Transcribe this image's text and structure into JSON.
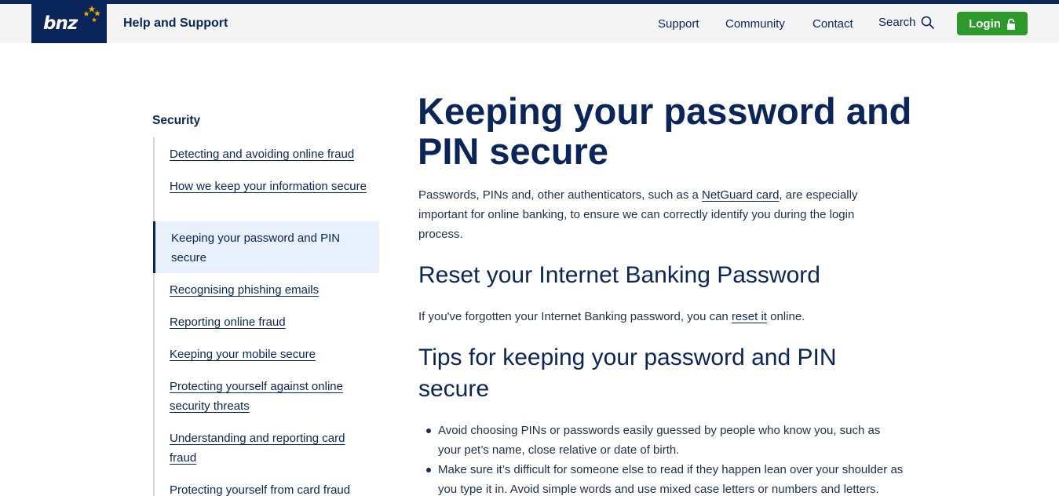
{
  "header": {
    "logo_text": "bnz",
    "site_title": "Help and Support",
    "nav": [
      "Support",
      "Community",
      "Contact",
      "Search"
    ],
    "login_label": "Login",
    "colors": {
      "navy": "#0a2559",
      "login_green": "#2b9a2b",
      "star_gold": "#f2a900"
    }
  },
  "sidebar": {
    "heading": "Security",
    "items": [
      {
        "label": "Detecting and avoiding online fraud",
        "active": false
      },
      {
        "label": "How we keep your information secure",
        "active": false
      },
      {
        "label": "Keeping your password and PIN secure",
        "active": true
      },
      {
        "label": "Recognising phishing emails",
        "active": false
      },
      {
        "label": "Reporting online fraud",
        "active": false
      },
      {
        "label": "Keeping your mobile secure",
        "active": false
      },
      {
        "label": "Protecting yourself against online security threats",
        "active": false
      },
      {
        "label": "Understanding and reporting card fraud",
        "active": false
      },
      {
        "label": "Protecting yourself from card fraud",
        "active": false
      }
    ]
  },
  "main": {
    "title": "Keeping your password and PIN secure",
    "intro": {
      "before_link": "Passwords, PINs and, other authenticators, such as a ",
      "link": "NetGuard card",
      "after_link": ", are especially important for online banking, to ensure we can correctly identify you during the login process."
    },
    "reset_heading": "Reset your Internet Banking Password",
    "reset_text": {
      "before_link": "If you've forgotten your Internet Banking password, you can ",
      "link": "reset it",
      "after_link": " online."
    },
    "tips_heading": "Tips for keeping your password and PIN secure",
    "tips": [
      "Avoid choosing PINs or passwords easily guessed by people who know you, such as your pet’s name, close relative or date of birth.",
      "Make sure it’s difficult for someone else to read if they happen lean over your shoulder as you type it in. Avoid simple words and use mixed case letters or numbers and letters."
    ]
  }
}
